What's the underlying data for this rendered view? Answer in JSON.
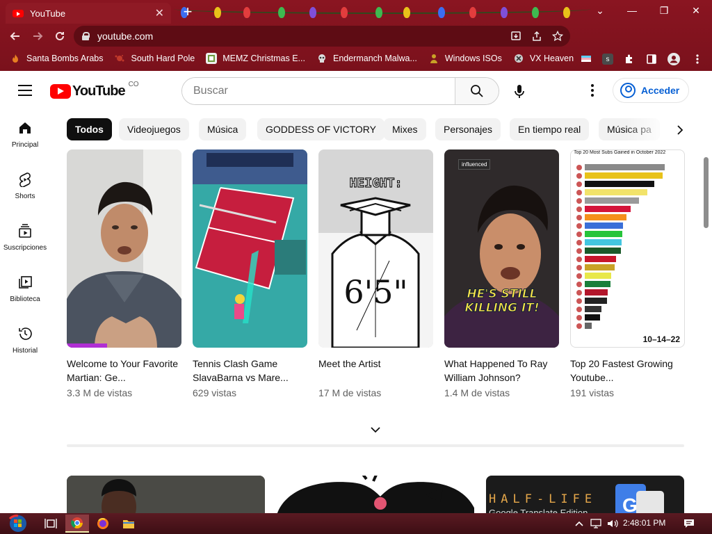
{
  "browser": {
    "tab_title": "YouTube",
    "tab_close": "✕",
    "new_tab": "+",
    "url": "youtube.com",
    "window_controls": {
      "minimize": "—",
      "maximize": "❐",
      "close": "✕",
      "tab_search": "⌄"
    }
  },
  "bookmarks": [
    {
      "label": "Santa Bombs Arabs",
      "icon": "fire-icon",
      "color": "#d35400"
    },
    {
      "label": "South Hard Pole",
      "icon": "splat-icon",
      "color": "#c0392b"
    },
    {
      "label": "MEMZ Christmas E...",
      "icon": "memz-icon",
      "color": "#f1f1f1"
    },
    {
      "label": "Endermanch Malwa...",
      "icon": "skull-icon",
      "color": "#dddddd"
    },
    {
      "label": "Windows ISOs",
      "icon": "person-icon",
      "color": "#b8860b"
    },
    {
      "label": "VX Heaven",
      "icon": "vx-icon",
      "color": "#cccccc"
    }
  ],
  "youtube": {
    "logo_text": "YouTube",
    "country_code": "CO",
    "search_placeholder": "Buscar",
    "sign_in": "Acceder",
    "guide": [
      {
        "label": "Principal",
        "icon": "home-icon"
      },
      {
        "label": "Shorts",
        "icon": "shorts-icon"
      },
      {
        "label": "Suscripciones",
        "icon": "subscriptions-icon"
      },
      {
        "label": "Biblioteca",
        "icon": "library-icon"
      },
      {
        "label": "Historial",
        "icon": "history-icon"
      }
    ],
    "chips": [
      "Todos",
      "Videojuegos",
      "Música",
      "GODDESS OF VICTORY",
      "Mixes",
      "Personajes",
      "En tiempo real",
      "Música pa"
    ],
    "shorts": [
      {
        "title": "Welcome to Your Favorite Martian: Ge...",
        "views": "3.3 M de vistas"
      },
      {
        "title": "Tennis Clash Game SlavaBarna vs Mare...",
        "views": "629 vistas"
      },
      {
        "title": "Meet the Artist",
        "views": "17 M de vistas",
        "thumb_text_top": "HEIGHT:",
        "thumb_text_mid": "6'5\""
      },
      {
        "title": "What Happened To Ray William Johnson?",
        "views": "1.4 M de vistas",
        "thumb_badge": "influenced",
        "thumb_caption": "HE'S STILL KILLING IT!"
      },
      {
        "title": "Top 20 Fastest Growing Youtube...",
        "views": "191 vistas",
        "thumb_heading": "Top 20 Most Subs Gained in October 2022",
        "thumb_date": "10–14–22"
      }
    ],
    "row2": {
      "hl_text": "HALF-LIFE",
      "hl_sub": "Google Translate Edition"
    }
  },
  "taskbar": {
    "clock": "2:48:01 PM"
  }
}
